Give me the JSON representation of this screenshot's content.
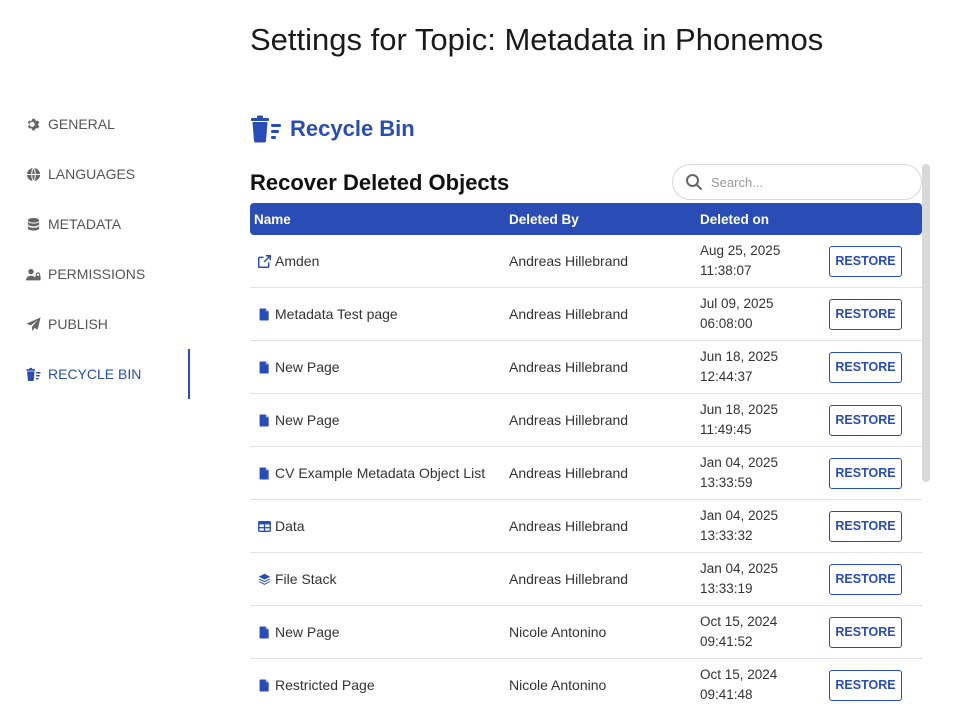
{
  "page_title": "Settings for Topic: Metadata in Phonemos",
  "sidebar": {
    "items": [
      {
        "label": "GENERAL",
        "icon": "gear-icon"
      },
      {
        "label": "LANGUAGES",
        "icon": "globe-icon"
      },
      {
        "label": "METADATA",
        "icon": "database-icon"
      },
      {
        "label": "PERMISSIONS",
        "icon": "users-lock-icon"
      },
      {
        "label": "PUBLISH",
        "icon": "paper-plane-icon"
      },
      {
        "label": "RECYCLE BIN",
        "icon": "trash-icon",
        "active": true
      }
    ]
  },
  "section": {
    "title": "Recycle Bin",
    "subtitle": "Recover Deleted Objects"
  },
  "search": {
    "placeholder": "Search..."
  },
  "table": {
    "headers": {
      "name": "Name",
      "deleted_by": "Deleted By",
      "deleted_on": "Deleted on"
    },
    "restore_label": "RESTORE",
    "rows": [
      {
        "icon": "external-link-icon",
        "name": "Amden",
        "deleted_by": "Andreas Hillebrand",
        "date": "Aug 25, 2025",
        "time": "11:38:07"
      },
      {
        "icon": "file-icon",
        "name": "Metadata Test page",
        "deleted_by": "Andreas Hillebrand",
        "date": "Jul 09, 2025",
        "time": "06:08:00"
      },
      {
        "icon": "file-icon",
        "name": "New Page",
        "deleted_by": "Andreas Hillebrand",
        "date": "Jun 18, 2025",
        "time": "12:44:37"
      },
      {
        "icon": "file-icon",
        "name": "New Page",
        "deleted_by": "Andreas Hillebrand",
        "date": "Jun 18, 2025",
        "time": "11:49:45"
      },
      {
        "icon": "file-icon",
        "name": "CV Example Metadata Object List",
        "deleted_by": "Andreas Hillebrand",
        "date": "Jan 04, 2025",
        "time": "13:33:59"
      },
      {
        "icon": "table-icon",
        "name": "Data",
        "deleted_by": "Andreas Hillebrand",
        "date": "Jan 04, 2025",
        "time": "13:33:32"
      },
      {
        "icon": "layers-icon",
        "name": "File Stack",
        "deleted_by": "Andreas Hillebrand",
        "date": "Jan 04, 2025",
        "time": "13:33:19"
      },
      {
        "icon": "file-icon",
        "name": "New Page",
        "deleted_by": "Nicole Antonino",
        "date": "Oct 15, 2024",
        "time": "09:41:52"
      },
      {
        "icon": "file-icon",
        "name": "Restricted Page",
        "deleted_by": "Nicole Antonino",
        "date": "Oct 15, 2024",
        "time": "09:41:48"
      }
    ]
  },
  "colors": {
    "accent": "#2a4db5",
    "nav_text": "#555555",
    "border": "#e3e3e3"
  }
}
